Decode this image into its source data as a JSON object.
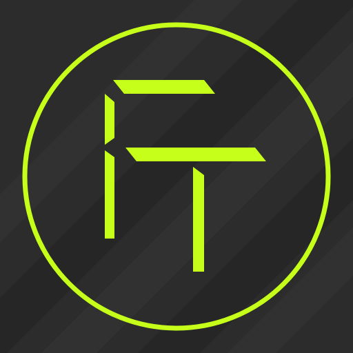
{
  "app_icon": {
    "logo_lettering": "FT",
    "icon_name": "ft-monogram-logo-icon",
    "colors": {
      "background": "#2c2c2c",
      "stripe_dark": "#262626",
      "stripe_light": "#333333",
      "accent": "#c6ff1a"
    }
  }
}
